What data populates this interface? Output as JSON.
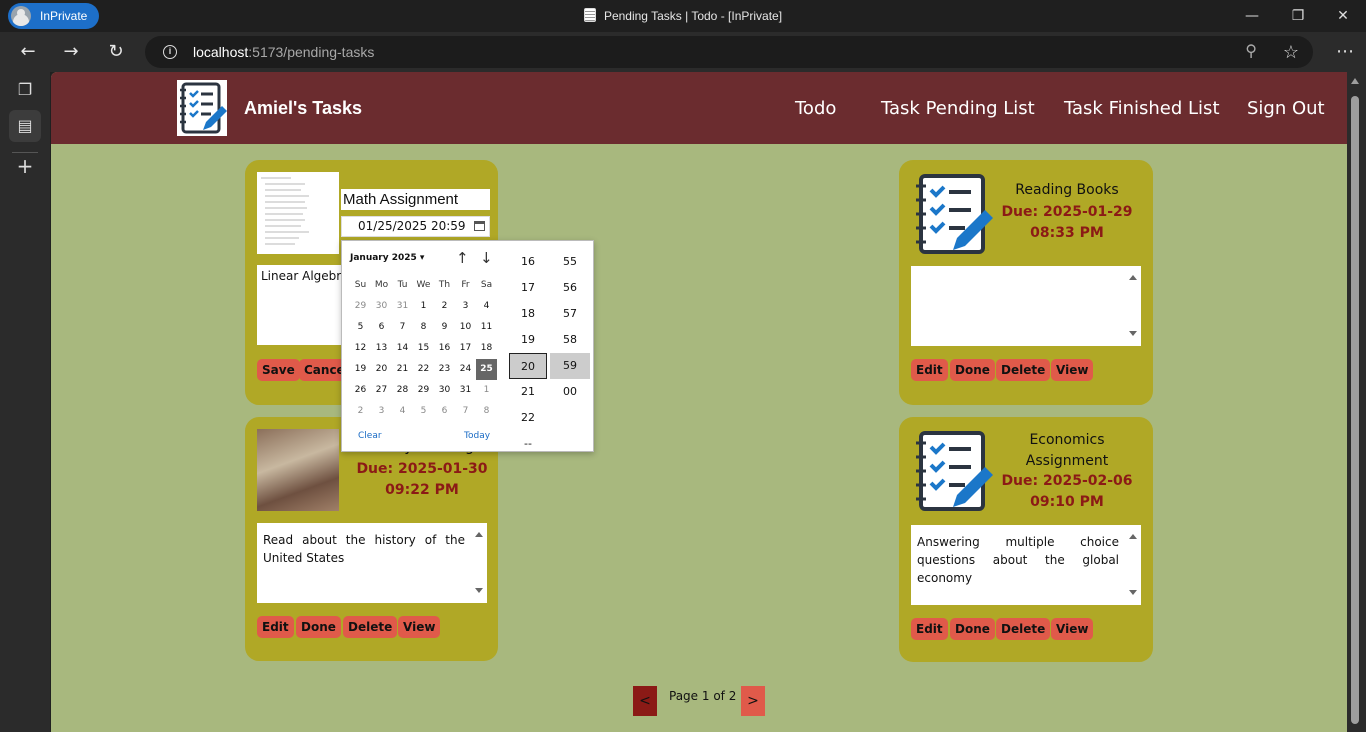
{
  "browser": {
    "inprivate_label": "InPrivate",
    "window_title": "Pending Tasks | Todo - [InPrivate]",
    "url_host": "localhost",
    "url_path": ":5173/pending-tasks"
  },
  "app": {
    "brand": "Amiel's Tasks",
    "nav": [
      "Todo",
      "Task Pending List",
      "Task Finished List",
      "Sign Out"
    ]
  },
  "editing_card": {
    "title_value": "Math Assignment",
    "date_value": "01/25/2025 20:59",
    "description": "Linear Algebra A course about ve",
    "save_label": "Save",
    "cancel_label": "Cancel"
  },
  "picker": {
    "month_label": "January 2025",
    "weekdays": [
      "Su",
      "Mo",
      "Tu",
      "We",
      "Th",
      "Fr",
      "Sa"
    ],
    "weeks": [
      [
        "29",
        "30",
        "31",
        "1",
        "2",
        "3",
        "4"
      ],
      [
        "5",
        "6",
        "7",
        "8",
        "9",
        "10",
        "11"
      ],
      [
        "12",
        "13",
        "14",
        "15",
        "16",
        "17",
        "18"
      ],
      [
        "19",
        "20",
        "21",
        "22",
        "23",
        "24",
        "25"
      ],
      [
        "26",
        "27",
        "28",
        "29",
        "30",
        "31",
        "1"
      ],
      [
        "2",
        "3",
        "4",
        "5",
        "6",
        "7",
        "8"
      ]
    ],
    "selected_day": "25",
    "hours": [
      "16",
      "17",
      "18",
      "19",
      "20",
      "21",
      "22",
      "--"
    ],
    "selected_hour": "20",
    "minutes": [
      "55",
      "56",
      "57",
      "58",
      "59",
      "00"
    ],
    "selected_minute": "59",
    "clear_label": "Clear",
    "today_label": "Today"
  },
  "history_card": {
    "title": "History Readings",
    "due_line1": "Due: 2025-01-30",
    "due_line2": "09:22 PM",
    "description": "Read about the history of the United States",
    "buttons": [
      "Edit",
      "Done",
      "Delete",
      "View"
    ]
  },
  "reading_card": {
    "title": "Reading Books",
    "due_line1": "Due: 2025-01-29",
    "due_line2": "08:33 PM",
    "description": "",
    "buttons": [
      "Edit",
      "Done",
      "Delete",
      "View"
    ]
  },
  "economics_card": {
    "title_line1": "Economics",
    "title_line2": "Assignment",
    "due_line1": "Due: 2025-02-06",
    "due_line2": "09:10 PM",
    "description": "Answering multiple choice questions about the global economy",
    "buttons": [
      "Edit",
      "Done",
      "Delete",
      "View"
    ]
  },
  "pagination": {
    "prev_label": "<",
    "next_label": ">",
    "info": "Page 1 of 2"
  },
  "colors": {
    "header": "#6b2c2f",
    "page_bg": "#a8b87e",
    "card": "#b0a826",
    "button": "#e05a4a",
    "due_text": "#8b1a16"
  }
}
